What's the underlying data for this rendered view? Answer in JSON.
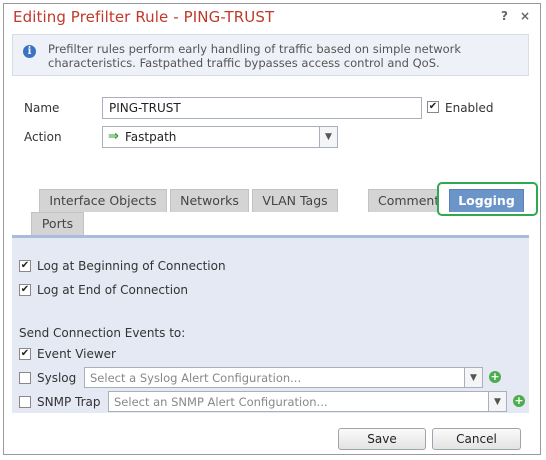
{
  "dialog": {
    "title": "Editing Prefilter Rule - PING-TRUST",
    "help": "?",
    "close": "×"
  },
  "info": {
    "icon_char": "i",
    "text": "Prefilter rules perform early handling of traffic based on simple network characteristics. Fastpathed traffic bypasses access control and QoS."
  },
  "form": {
    "name_label": "Name",
    "name_value": "PING-TRUST",
    "enabled_label": "Enabled",
    "enabled_checked": "✔",
    "action_label": "Action",
    "action_value": "Fastpath",
    "action_arrow": "⇒",
    "caret": "▼"
  },
  "tabs": {
    "interface_objects": "Interface Objects",
    "networks": "Networks",
    "vlan_tags": "VLAN Tags",
    "comments": "Comments",
    "logging": "Logging",
    "ports": "Ports"
  },
  "logging": {
    "check_mark": "✔",
    "log_begin": "Log at Beginning of Connection",
    "log_end": "Log at End of Connection",
    "send_events_label": "Send Connection Events to:",
    "event_viewer": "Event Viewer",
    "syslog": "Syslog",
    "syslog_placeholder": "Select a Syslog Alert Configuration...",
    "snmp": "SNMP Trap",
    "snmp_placeholder": "Select an SNMP Alert Configuration...",
    "plus": "+"
  },
  "footer": {
    "save": "Save",
    "cancel": "Cancel"
  },
  "colors": {
    "title": "#c0392b",
    "active_tab": "#6b94c9",
    "highlight": "#2fa84f",
    "panel": "#e4e9f3"
  }
}
